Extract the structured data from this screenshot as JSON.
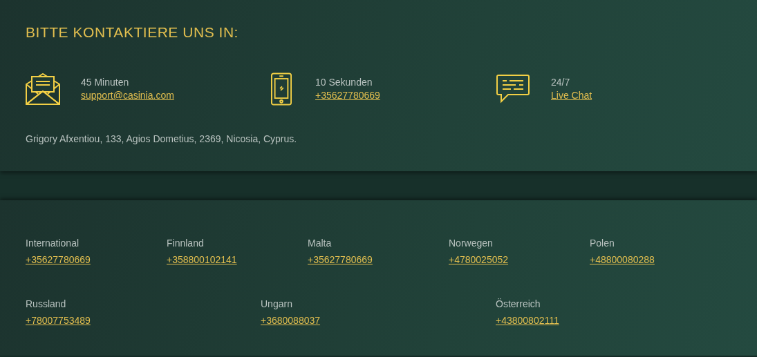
{
  "contact": {
    "title": "BITTE KONTAKTIERE UNS IN:",
    "channels": [
      {
        "kind": "email",
        "note": "45 Minuten",
        "link": "support@casinia.com"
      },
      {
        "kind": "phone",
        "note": "10 Sekunden",
        "link": "+35627780669"
      },
      {
        "kind": "chat",
        "note": "24/7",
        "link": "Live Chat"
      }
    ],
    "address": "Grigory Afxentiou, 133, Agios Dometius, 2369, Nicosia, Cyprus."
  },
  "phones": {
    "rows": [
      [
        {
          "country": "International",
          "number": "+35627780669"
        },
        {
          "country": "Finnland",
          "number": "+358800102141"
        },
        {
          "country": "Malta",
          "number": "+35627780669"
        },
        {
          "country": "Norwegen",
          "number": "+4780025052"
        },
        {
          "country": "Polen",
          "number": "+48800080288"
        }
      ],
      [
        {
          "country": "Russland",
          "number": "+78007753489"
        },
        {
          "country": "Ungarn",
          "number": "+3680088037"
        },
        {
          "country": "Österreich",
          "number": "+43800802111"
        }
      ]
    ]
  }
}
